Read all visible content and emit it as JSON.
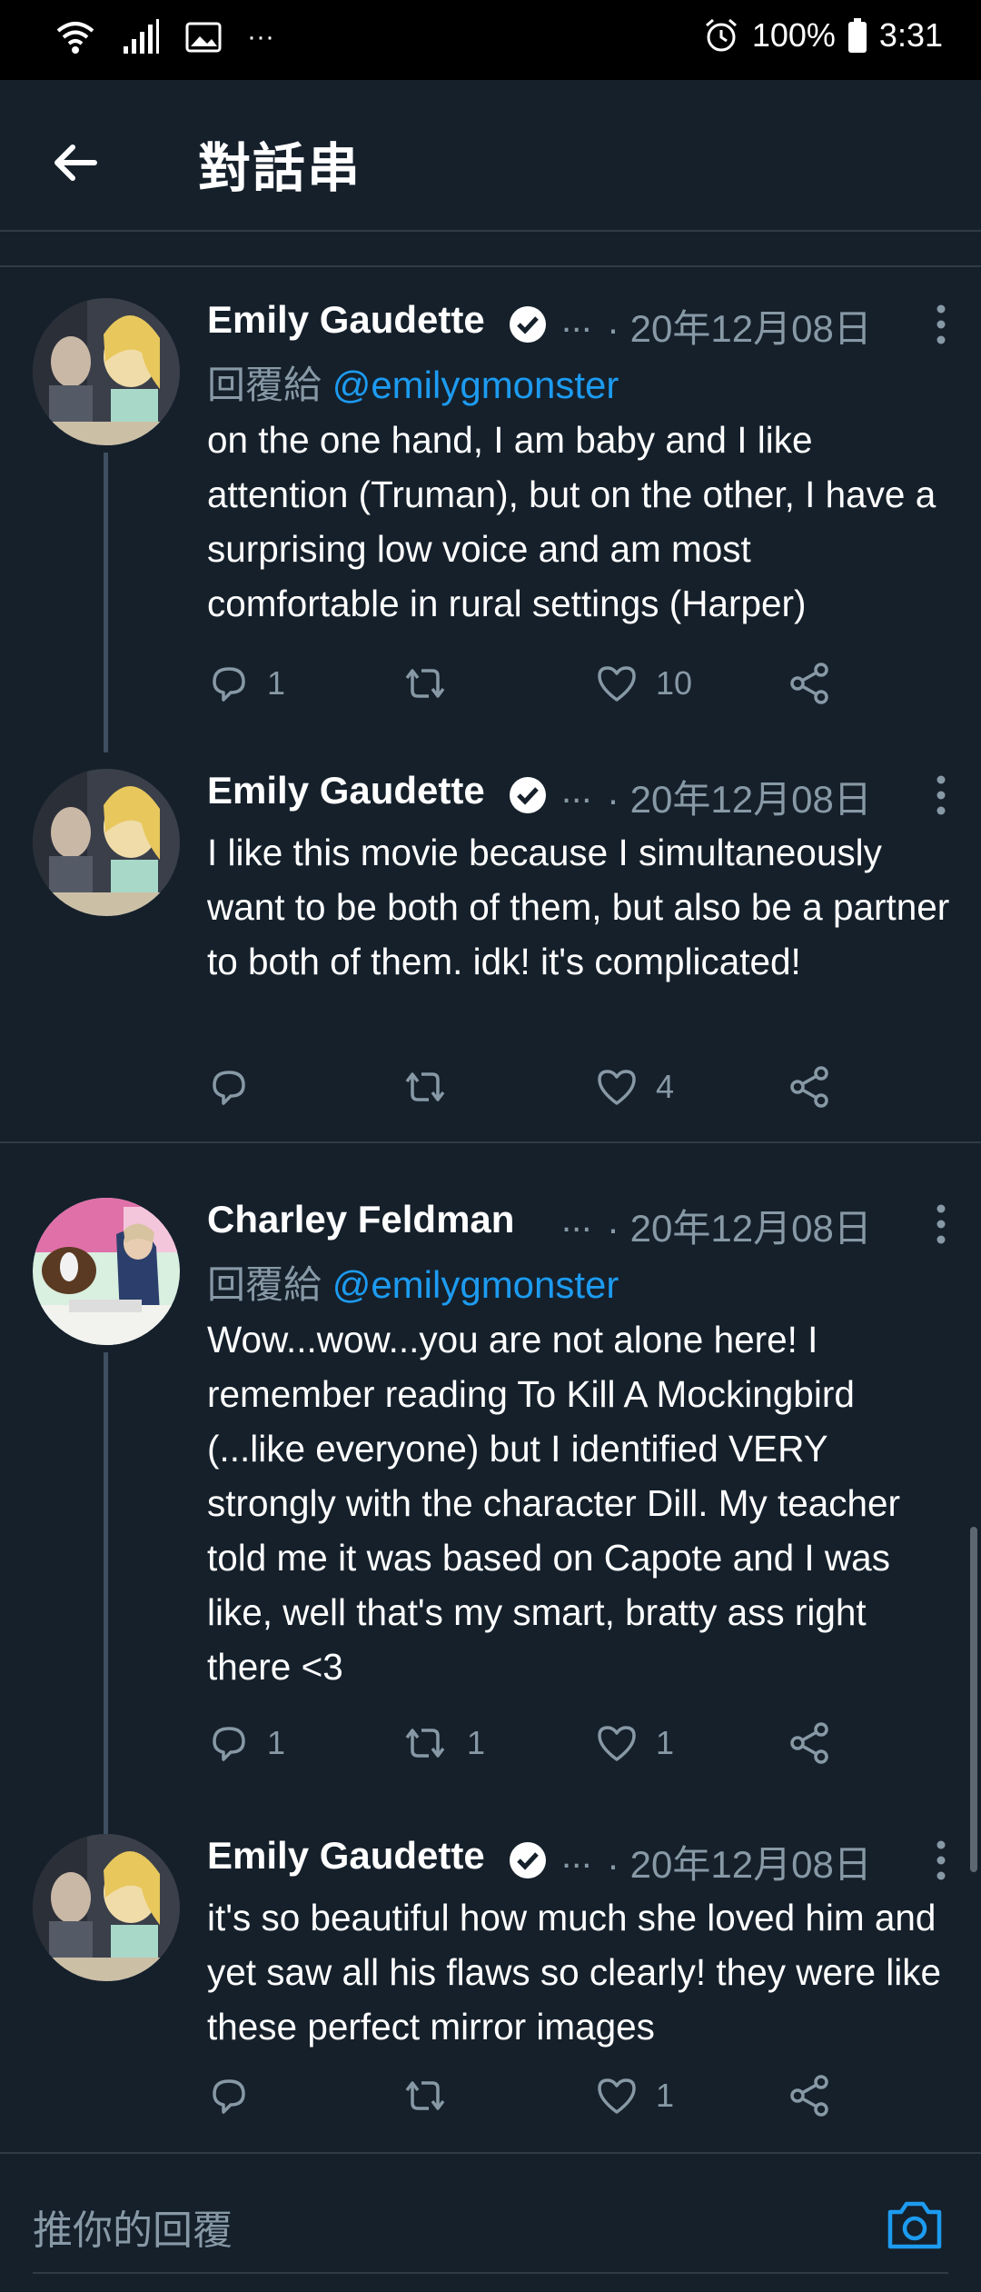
{
  "status_bar": {
    "battery": "100%",
    "time": "3:31",
    "more": "···"
  },
  "header": {
    "title": "對話串"
  },
  "tweets": [
    {
      "name": "Emily Gaudette",
      "verified": true,
      "ellipsis": "...",
      "date": "· 20年12月08日",
      "reply_prefix": "回覆給",
      "reply_handle": "@emilygmonster",
      "text": "on the one hand, I am baby and I like attention (Truman), but on the other, I have a surprising low voice and am most comfortable in rural settings (Harper)",
      "reply_count": "1",
      "retweet_count": "",
      "like_count": "10"
    },
    {
      "name": "Emily Gaudette",
      "verified": true,
      "ellipsis": "...",
      "date": "· 20年12月08日",
      "text": "I like this movie because I simultaneously want to be both of them, but also be a partner to both of them. idk! it's complicated!",
      "reply_count": "",
      "retweet_count": "",
      "like_count": "4"
    },
    {
      "name": "Charley Feldman",
      "verified": false,
      "ellipsis": "...",
      "date": "· 20年12月08日",
      "reply_prefix": "回覆給",
      "reply_handle": "@emilygmonster",
      "text": "Wow...wow...you are not alone here! I remember reading To Kill A Mockingbird (...like everyone) but I identified VERY strongly with the character Dill. My teacher told me it was based on Capote and I was like, well that's my smart, bratty ass right there <3",
      "reply_count": "1",
      "retweet_count": "1",
      "like_count": "1"
    },
    {
      "name": "Emily Gaudette",
      "verified": true,
      "ellipsis": "...",
      "date": "· 20年12月08日",
      "text": "it's so beautiful how much she loved him and yet saw all his flaws so clearly! they were like these perfect mirror images",
      "reply_count": "",
      "retweet_count": "",
      "like_count": "1"
    }
  ],
  "compose": {
    "placeholder": "推你的回覆"
  },
  "colors": {
    "background": "#15202b",
    "accent": "#1d9bf0",
    "muted": "#8899a6",
    "divider": "#2f3b47"
  }
}
